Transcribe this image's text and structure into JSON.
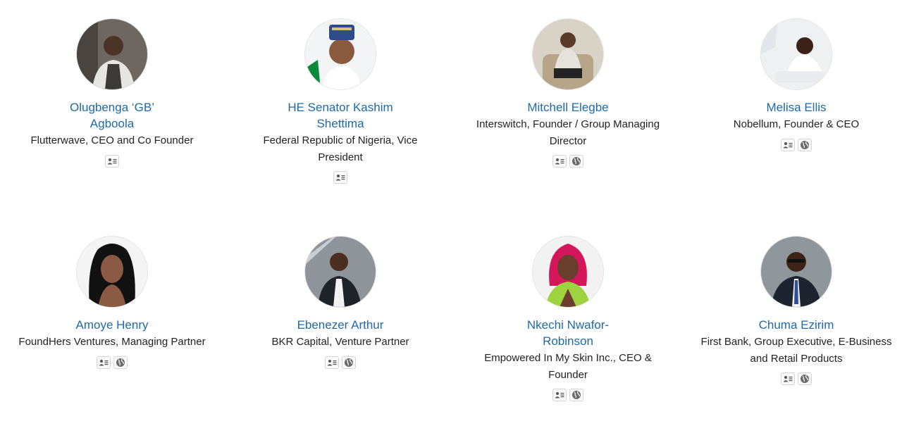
{
  "people": [
    {
      "name_line1": "Olugbenga ‘GB’",
      "name_line2": "Agboola",
      "role_line1": "Flutterwave, CEO and Co Founder",
      "role_line2": "",
      "icons": [
        "contact-card-icon"
      ]
    },
    {
      "name_line1": "HE Senator Kashim",
      "name_line2": "Shettima",
      "role_line1": "Federal Republic of Nigeria, Vice",
      "role_line2": "President",
      "icons": [
        "contact-card-icon"
      ]
    },
    {
      "name_line1": "Mitchell Elegbe",
      "name_line2": "",
      "role_line1": "Interswitch, Founder / Group Managing",
      "role_line2": "Director",
      "icons": [
        "contact-card-icon",
        "globe-icon"
      ]
    },
    {
      "name_line1": "Melisa Ellis",
      "name_line2": "",
      "role_line1": "Nobellum, Founder & CEO",
      "role_line2": "",
      "icons": [
        "contact-card-icon",
        "globe-icon"
      ]
    },
    {
      "name_line1": "Amoye Henry",
      "name_line2": "",
      "role_line1": "FoundHers Ventures, Managing Partner",
      "role_line2": "",
      "icons": [
        "contact-card-icon",
        "globe-icon"
      ]
    },
    {
      "name_line1": "Ebenezer Arthur",
      "name_line2": "",
      "role_line1": "BKR Capital, Venture Partner",
      "role_line2": "",
      "icons": [
        "contact-card-icon",
        "globe-icon"
      ]
    },
    {
      "name_line1": "Nkechi Nwafor-",
      "name_line2": "Robinson",
      "role_line1": "Empowered In My Skin Inc., CEO &",
      "role_line2": "Founder",
      "icons": [
        "contact-card-icon",
        "globe-icon"
      ]
    },
    {
      "name_line1": "Chuma Ezirim",
      "name_line2": "",
      "role_line1": "First Bank, Group Executive, E-Business",
      "role_line2": "and Retail Products",
      "icons": [
        "contact-card-icon",
        "globe-icon"
      ]
    }
  ],
  "colors": {
    "name_link": "#1f6aa5",
    "text": "#222222",
    "icon_border": "#d5d5d5"
  }
}
